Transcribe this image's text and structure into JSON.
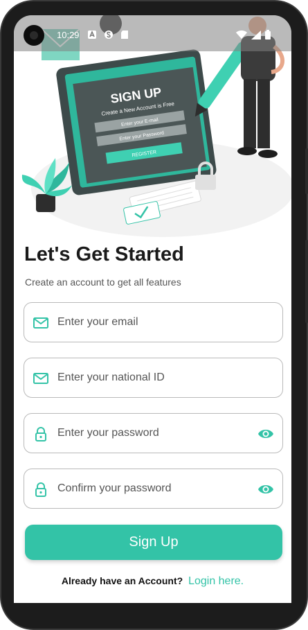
{
  "status_bar": {
    "time": "10:29"
  },
  "illustration": {
    "card_title": "SIGN UP",
    "card_subtitle": "Create a New Account is Free",
    "card_email": "Enter your E-mail",
    "card_password": "Enter your Password",
    "card_button": "REGISTER"
  },
  "header": {
    "title": "Let's Get Started",
    "subtitle": "Create an account to get all features"
  },
  "form": {
    "email_placeholder": "Enter your email",
    "national_id_placeholder": "Enter your national ID",
    "password_placeholder": "Enter your password",
    "confirm_placeholder": "Confirm your password",
    "submit_label": "Sign Up"
  },
  "footer": {
    "question": "Already have an Account?",
    "login_link": "Login here."
  },
  "colors": {
    "accent": "#33c3a7",
    "text_dark": "#1a1a1a",
    "text_muted": "#555555",
    "field_border": "#b9b9b9"
  },
  "icons": [
    "mail-icon",
    "lock-icon",
    "eye-icon",
    "wifi-icon",
    "signal-icon",
    "battery-icon"
  ]
}
